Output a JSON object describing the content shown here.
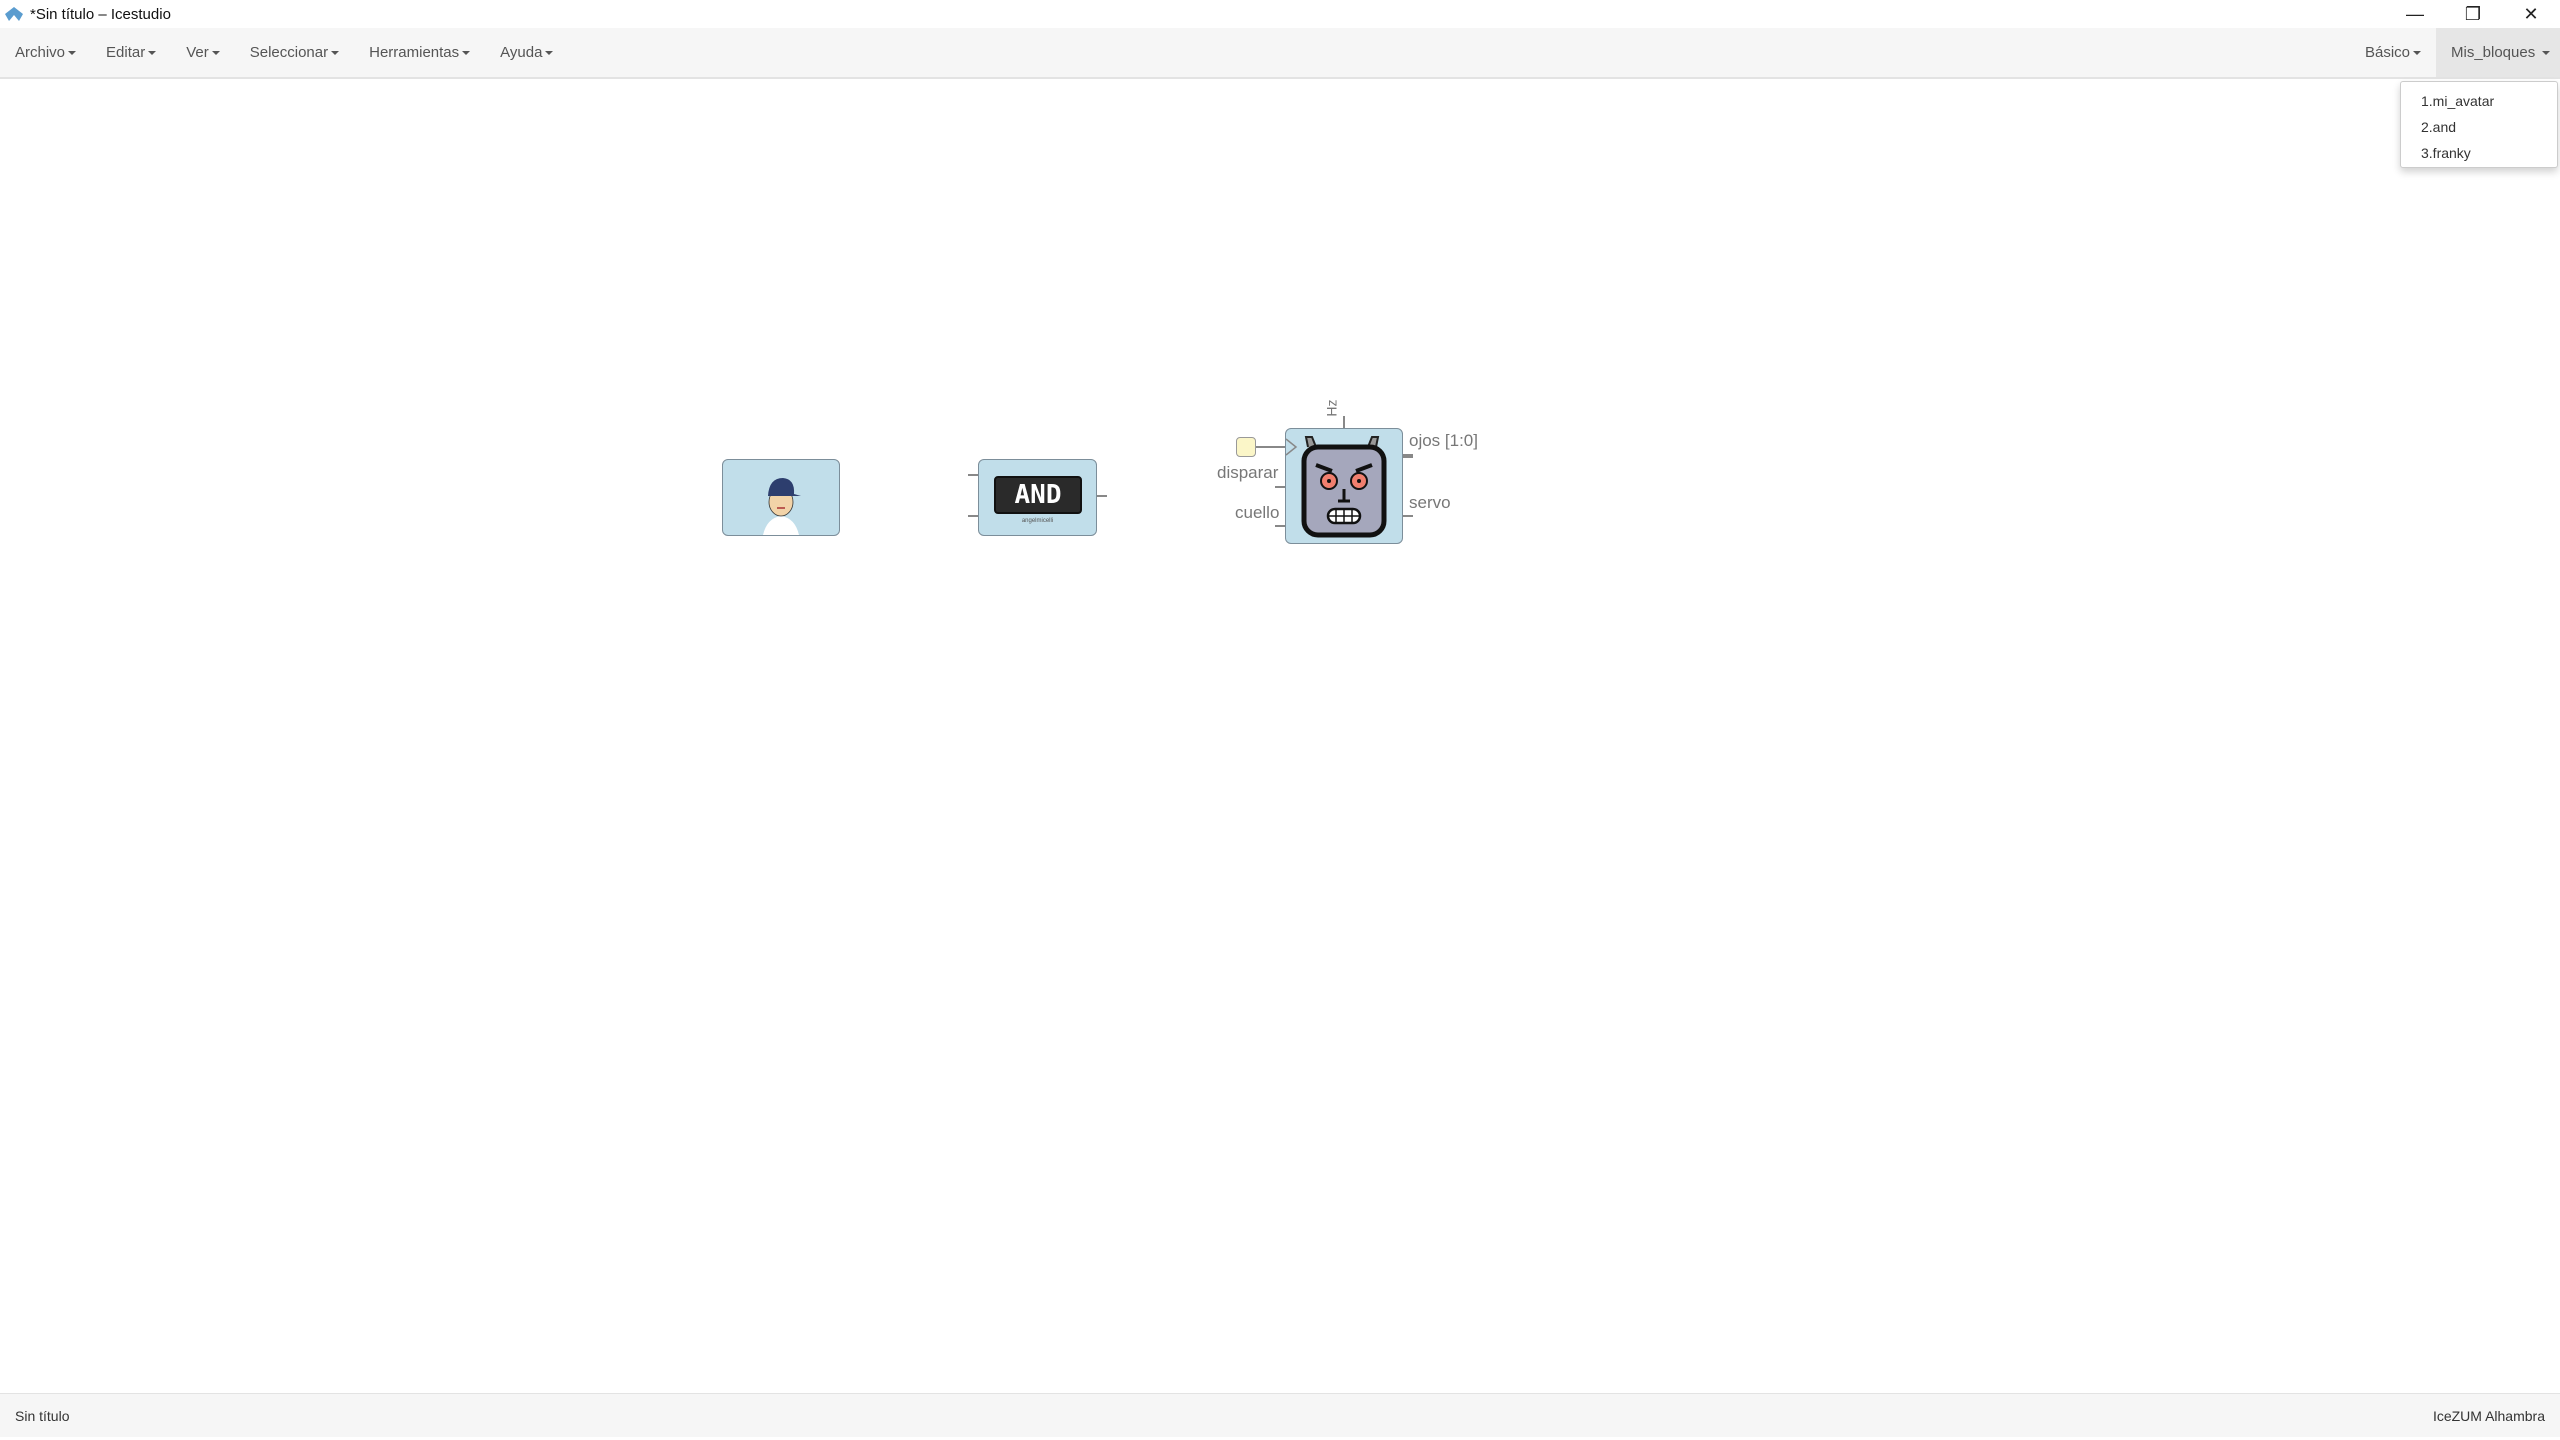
{
  "window": {
    "title": "*Sin título – Icestudio",
    "minimize": "—",
    "restore": "❐",
    "close": "✕"
  },
  "menu": {
    "items": [
      {
        "label": "Archivo"
      },
      {
        "label": "Editar"
      },
      {
        "label": "Ver"
      },
      {
        "label": "Seleccionar"
      },
      {
        "label": "Herramientas"
      },
      {
        "label": "Ayuda"
      }
    ],
    "basico": "Básico",
    "mis_bloques": "Mis_bloques"
  },
  "dropdown": {
    "items": [
      "1.mi_avatar",
      "2.and",
      "3.franky"
    ]
  },
  "canvas": {
    "and_block": {
      "text": "AND",
      "author": "angelmicelli"
    },
    "franky": {
      "param": "Hz",
      "inputs": [
        "disparar",
        "cuello"
      ],
      "outputs": [
        "ojos [1:0]",
        "servo"
      ]
    }
  },
  "status": {
    "left": "Sin título",
    "right": "IceZUM Alhambra"
  }
}
